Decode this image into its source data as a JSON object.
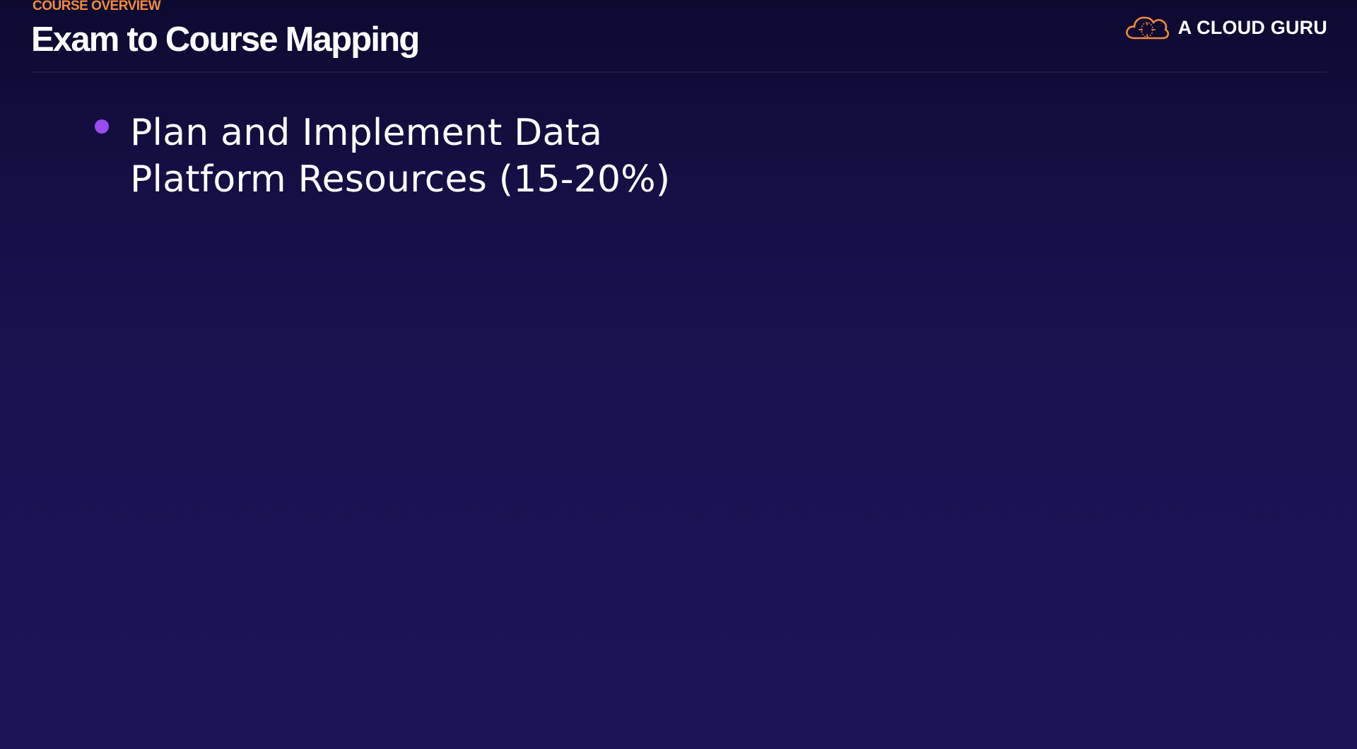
{
  "header": {
    "eyebrow": "COURSE OVERVIEW",
    "title": "Exam to Course Mapping"
  },
  "brand": {
    "name": "A CLOUD GURU",
    "logo_icon": "cloud-logo-icon",
    "logo_color": "#f28a3a"
  },
  "content": {
    "bullets": [
      {
        "line1": "Plan and Implement Data",
        "line2": "Platform Resources (15-20%)"
      }
    ]
  },
  "colors": {
    "background_top": "#0d0a30",
    "background_bottom": "#1b1456",
    "accent_orange": "#f28a3a",
    "bullet_purple": "#9a4cf0",
    "text": "#ffffff"
  }
}
